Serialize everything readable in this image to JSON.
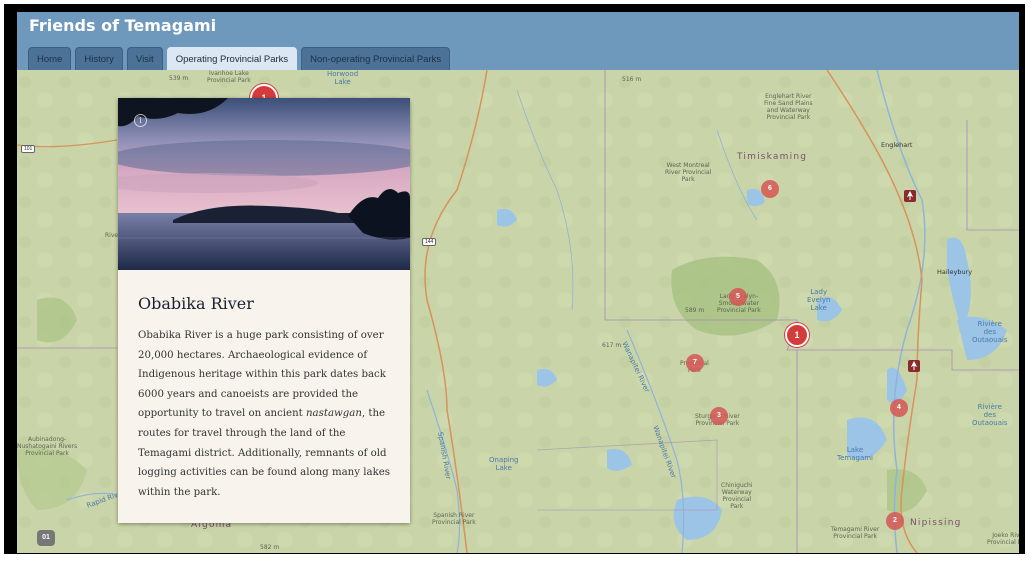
{
  "app": {
    "title": "Friends of Temagami"
  },
  "tabs": [
    {
      "label": "Home"
    },
    {
      "label": "History"
    },
    {
      "label": "Visit"
    },
    {
      "label": "Operating Provincial Parks"
    },
    {
      "label": "Non-operating Provincial Parks"
    }
  ],
  "active_tab": "Operating Provincial Parks",
  "card": {
    "title": "Obabika River",
    "body_before": "Obabika River is a huge park consisting of over 20,000 hectares. Archaeological evidence of Indigenous heritage within this park dates back 6000 years and canoeists are provided the opportunity to travel on ancient ",
    "body_emph": "nastawgan",
    "body_after": ", the routes for travel through the land of the Temagami district. Additionally, remnants of old logging activities can be found along many lakes within the park."
  },
  "markers": [
    {
      "label": "1",
      "active": true
    },
    {
      "label": "1"
    },
    {
      "label": "2"
    },
    {
      "label": "4"
    },
    {
      "label": "5"
    },
    {
      "label": "6"
    },
    {
      "label": "7"
    },
    {
      "label": "3"
    }
  ],
  "page_badge": "01",
  "map_labels": {
    "ivanhoe": "Ivanhoe Lake\nProvincial Park",
    "horwood": "Horwood\nLake",
    "e539": "539 m",
    "e516": "516 m",
    "e589": "589 m",
    "e617": "617 m",
    "e582": "582 m",
    "englehart_river": "Englehart River\nFine Sand Plains\nand Waterway\nProvincial Park",
    "englehart": "Englehart",
    "timiskaming": "Timiskaming",
    "west_montreal": "West Montreal\nRiver Provincial\nPark",
    "lady_evelyn_park": "Lady Evelyn-\nSmoothwater\nProvincial Park",
    "lady_evelyn_lake": "Lady\nEvelyn\nLake",
    "haileybury": "Haileybury",
    "riviere1": "Rivière\ndes\nOutaouais",
    "riviere2": "Rivière\ndes\nOutaouais",
    "wanapitei1": "Wanapitei River",
    "wanapitei2": "Wanapitei River",
    "spanish_river": "Spanish River",
    "onaping": "Onaping\nLake",
    "spanish_park": "Spanish River\nProvincial Park",
    "lake_temagami": "Lake\nTemagami",
    "temagami_river": "Temagami River\nProvincial Park",
    "nipissing": "Nipissing",
    "algoma": "Algoma",
    "chiniguchi": "Chiniguchi\nWaterway\nProvincial\nPark",
    "sturgeon": "Sturgeon River\nProvincial Park",
    "aubinadong": "Aubinadong-\nNushatogaini Rivers\nProvincial Park",
    "rapid_river": "Rapid River",
    "joeko": "Joeko Riv\nProvincial Pa",
    "pinetree": "Provincial\nPark",
    "hwy101": "101",
    "hwy144": "144",
    "rive": "Rive"
  },
  "colors": {
    "header": "#6f98bd",
    "tab_active": "#dbe8f3",
    "marker": "#d43c3c",
    "map_land": "#c8d4a6",
    "card_bg": "#f8f3ec"
  },
  "icons": {
    "info": "info-icon"
  }
}
